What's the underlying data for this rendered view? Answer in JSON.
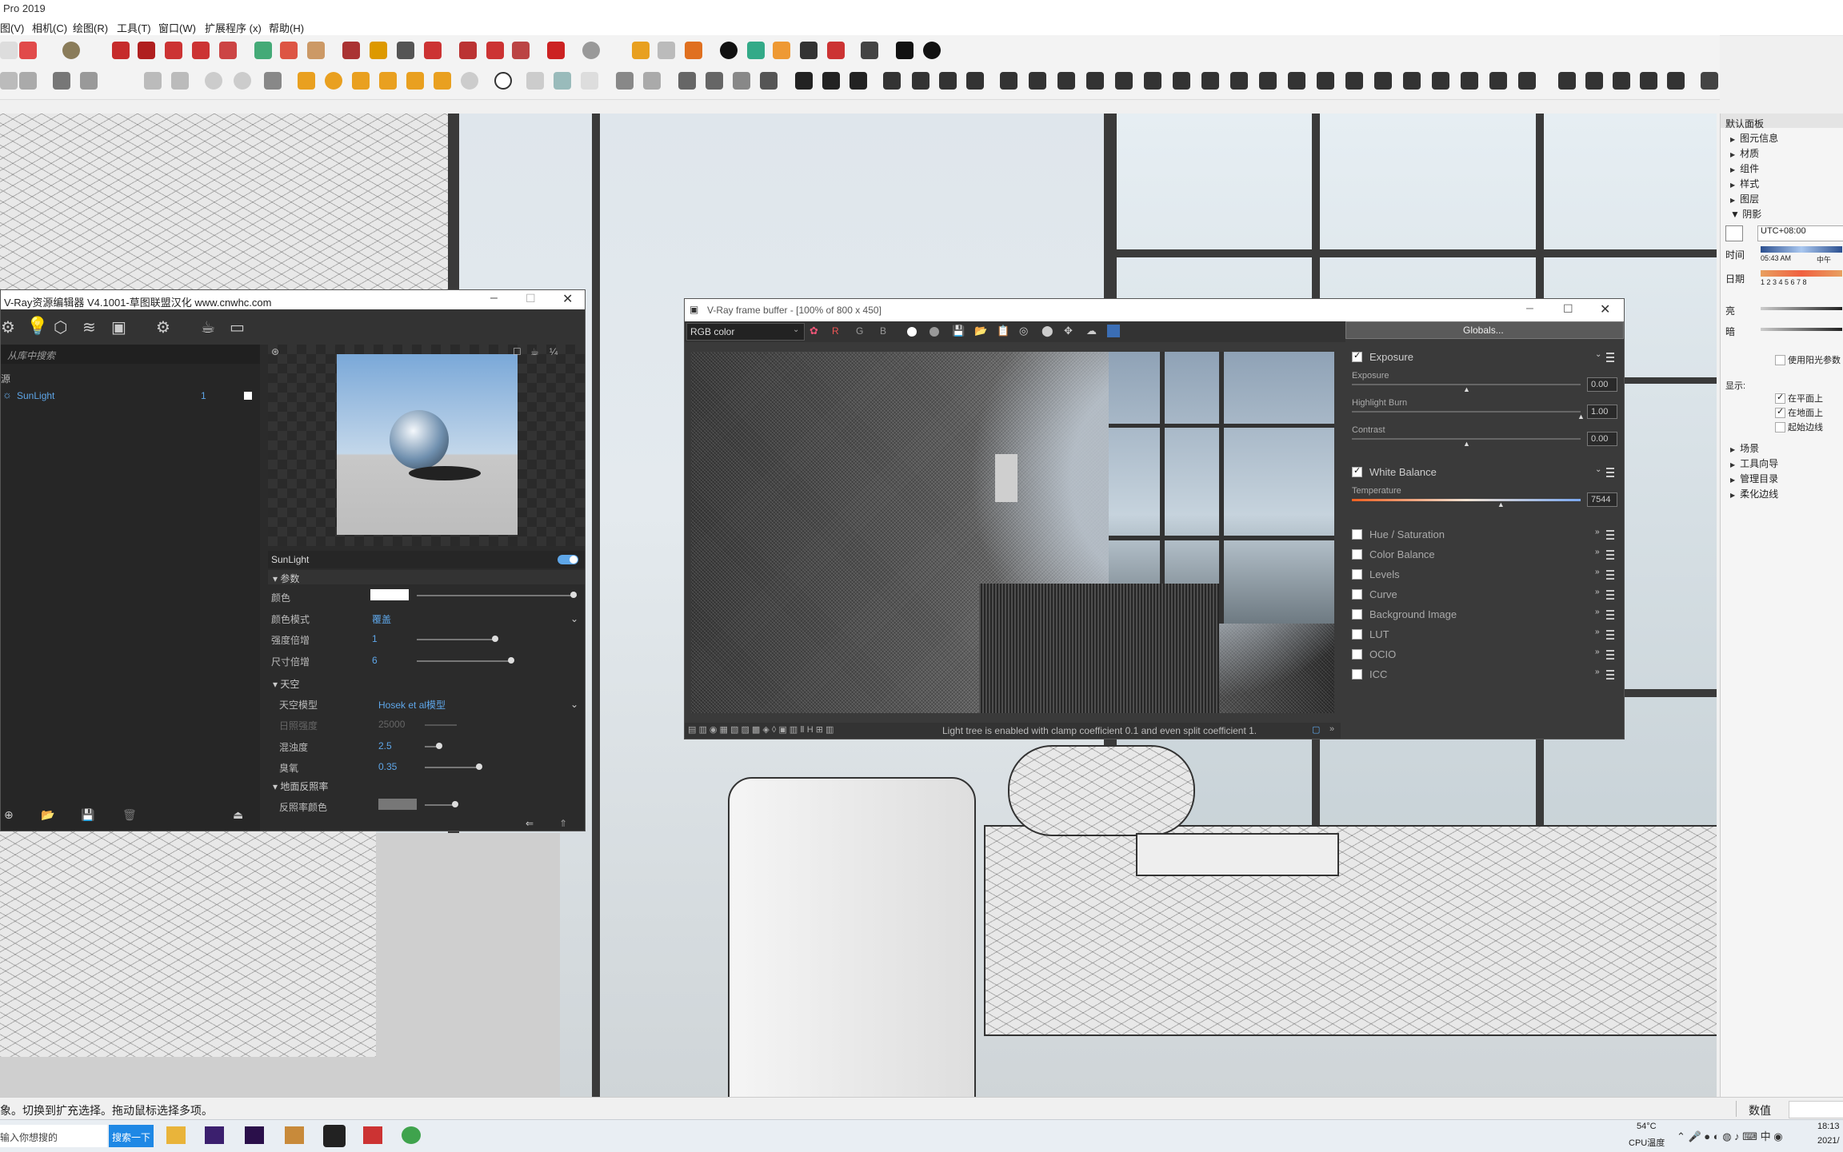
{
  "app": {
    "title": "Pro 2019"
  },
  "menu": [
    "图(V)",
    "相机(C)",
    "绘图(R)",
    "工具(T)",
    "窗口(W)",
    "扩展程序 (x)",
    "帮助(H)"
  ],
  "asset_editor": {
    "title": "V-Ray资源编辑器 V4.1001-草图联盟汉化 www.cnwhc.com",
    "search_placeholder": "从库中搜索",
    "list_header": "源",
    "item_name": "SunLight",
    "item_count": "1",
    "panel_title": "SunLight",
    "section_params": "参数",
    "color_label": "颜色",
    "color_mode_label": "颜色模式",
    "color_mode_value": "覆盖",
    "intensity_label": "强度倍增",
    "intensity_value": "1",
    "size_label": "尺寸倍增",
    "size_value": "6",
    "section_sky": "天空",
    "sky_model_label": "天空模型",
    "sky_model_value": "Hosek et al模型",
    "sun_intensity_label": "日照强度",
    "sun_intensity_value": "25000",
    "turbidity_label": "混浊度",
    "turbidity_value": "2.5",
    "ozone_label": "臭氧",
    "ozone_value": "0.35",
    "section_ground": "地面反照率",
    "albedo_color_label": "反照率颜色"
  },
  "frame_buffer": {
    "title": "V-Ray frame buffer - [100% of 800 x 450]",
    "channel": "RGB color",
    "rgb_buttons": [
      "R",
      "G",
      "B"
    ],
    "globals_button": "Globals...",
    "exposure_section": "Exposure",
    "exposure_label": "Exposure",
    "exposure_value": "0.00",
    "highlight_label": "Highlight Burn",
    "highlight_value": "1.00",
    "contrast_label": "Contrast",
    "contrast_value": "0.00",
    "wb_section": "White Balance",
    "temperature_label": "Temperature",
    "temperature_value": "7544",
    "layers": [
      "Hue / Saturation",
      "Color Balance",
      "Levels",
      "Curve",
      "Background Image",
      "LUT",
      "OCIO",
      "ICC"
    ],
    "status": "Light tree is enabled with clamp coefficient 0.1 and even split coefficient 1.",
    "exposure_pos": 0.5,
    "highlight_pos": 1.0,
    "contrast_pos": 0.5,
    "temperature_pos": 0.65
  },
  "tray": {
    "title": "默认面板",
    "items_top": [
      "图元信息",
      "材质",
      "组件",
      "样式",
      "图层"
    ],
    "shadow_title": "阴影",
    "timezone": "UTC+08:00",
    "time_label": "时间",
    "time_value": "05:43 AM",
    "time_extra": "中午",
    "date_label": "日期",
    "date_ticks": "1 2 3 4 5 6 7 8",
    "light_label": "亮",
    "dark_label": "暗",
    "use_sun": "使用阳光参数",
    "display_label": "显示:",
    "opt_face": "在平面上",
    "opt_ground": "在地面上",
    "opt_edges": "起始边线",
    "items_bottom": [
      "场景",
      "工具向导",
      "管理目录",
      "柔化边线"
    ]
  },
  "status": {
    "hint": "象。切换到扩充选择。拖动鼠标选择多项。",
    "measure_label": "数值"
  },
  "taskbar": {
    "search_placeholder": "输入你想搜的",
    "search_button": "搜索一下",
    "temp": "54°C",
    "temp_label": "CPU温度",
    "time": "18:13",
    "date": "2021/"
  }
}
